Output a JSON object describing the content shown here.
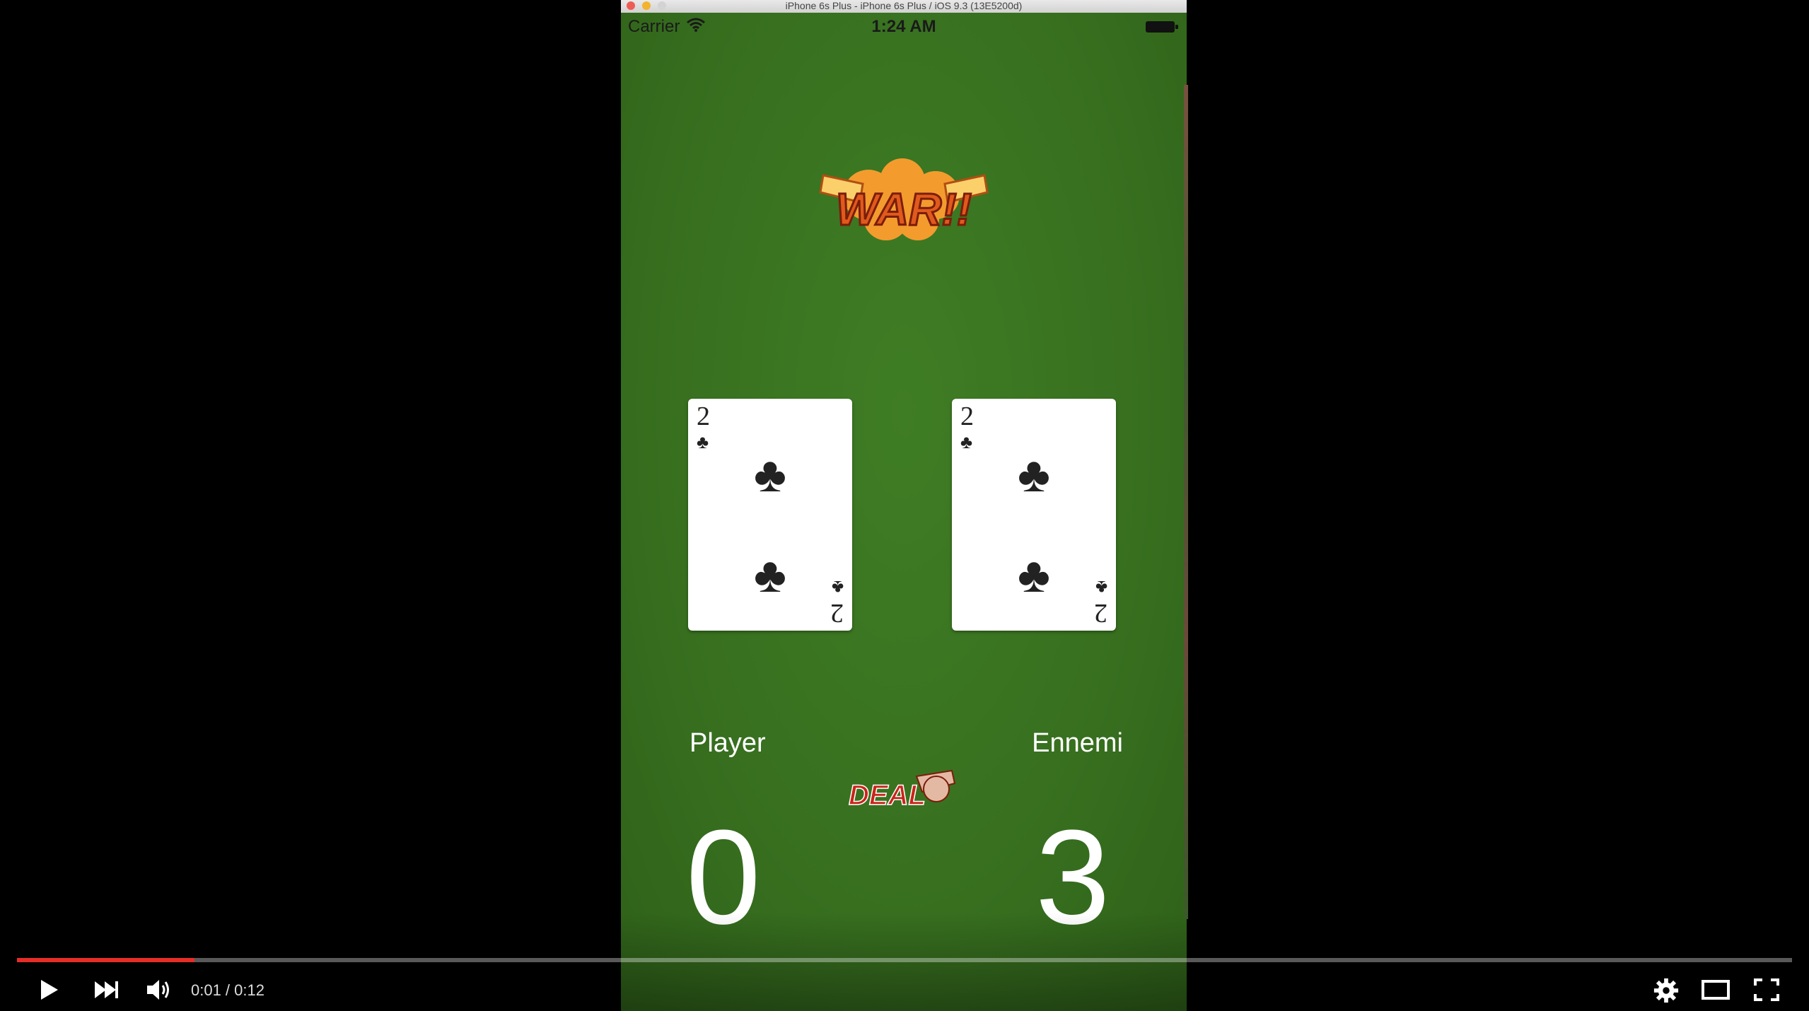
{
  "simulator": {
    "window_title": "iPhone 6s Plus - iPhone 6s Plus / iOS 9.3 (13E5200d)"
  },
  "status_bar": {
    "carrier": "Carrier",
    "time": "1:24 AM",
    "wifi_icon": "wifi-icon",
    "battery_icon": "battery-icon"
  },
  "game": {
    "logo_text": "WAR!!",
    "player_card": {
      "rank": "2",
      "suit": "♣"
    },
    "enemy_card": {
      "rank": "2",
      "suit": "♣"
    },
    "player_label": "Player",
    "enemy_label": "Ennemi",
    "deal_button_text": "DEAL",
    "player_score": "0",
    "enemy_score": "3"
  },
  "video_player": {
    "time_display": "0:01 / 0:12",
    "progress": 0.1,
    "icons": [
      "play-icon",
      "next-icon",
      "volume-icon",
      "settings-icon",
      "theater-icon",
      "fullscreen-icon"
    ],
    "accent_color": "#e52d27"
  }
}
